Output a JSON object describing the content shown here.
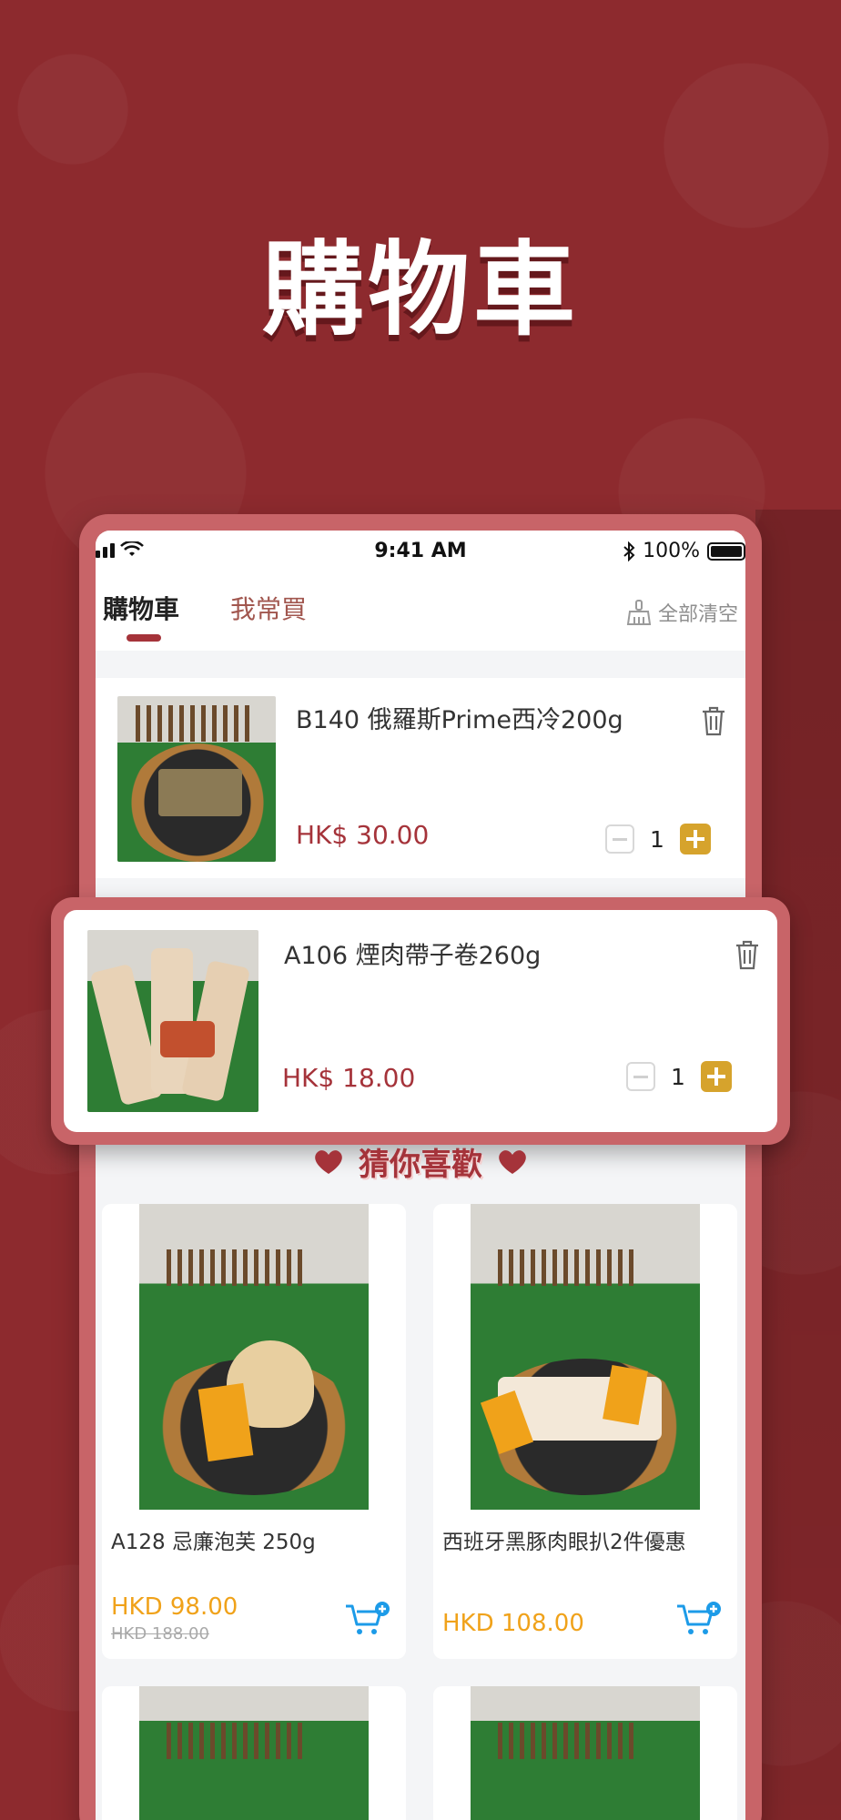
{
  "hero": {
    "title": "購物車"
  },
  "status_bar": {
    "time": "9:41 AM",
    "battery": "100%"
  },
  "tabs": {
    "active": "購物車",
    "inactive": "我常買",
    "clear_all": "全部清空"
  },
  "cart_items": [
    {
      "title": "B140 俄羅斯Prime西冷200g",
      "price": "HK$ 30.00",
      "qty": "1"
    },
    {
      "title": "A106 煙肉帶子卷260g",
      "price": "HK$ 18.00",
      "qty": "1"
    }
  ],
  "guess": {
    "heading": "猜你喜歡"
  },
  "products": [
    {
      "name": "A128 忌廉泡芙 250g",
      "price": "HKD 98.00",
      "old_price": "HKD 188.00"
    },
    {
      "name": "西班牙黑豚肉眼扒2件優惠",
      "price": "HKD 108.00"
    }
  ],
  "colors": {
    "background": "#8d2a2e",
    "accent": "#a5333a",
    "price_orange": "#f0a21a",
    "plus_gold": "#d6a32c",
    "cart_blue": "#1c9be8"
  },
  "icons": [
    "wifi-icon",
    "bluetooth-icon",
    "battery-icon",
    "broom-icon",
    "trash-icon",
    "minus-icon",
    "plus-icon",
    "heart-icon",
    "cart-add-icon"
  ]
}
